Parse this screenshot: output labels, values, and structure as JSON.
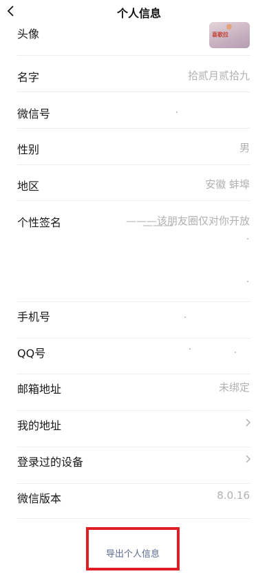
{
  "header": {
    "title": "个人信息"
  },
  "rows": {
    "avatar": {
      "label": "头像",
      "thumb_text": "喜歌拉"
    },
    "name": {
      "label": "名字",
      "value": "拾贰月贰拾九"
    },
    "wechat_id": {
      "label": "微信号",
      "value": ""
    },
    "gender": {
      "label": "性别",
      "value": "男"
    },
    "region": {
      "label": "地区",
      "value": "安徽 蚌埠"
    },
    "signature": {
      "label": "个性签名",
      "value_line1": "———该朋友圈仅对你开放",
      "value_line2": "———"
    },
    "phone": {
      "label": "手机号",
      "value": ""
    },
    "qq": {
      "label": "QQ号",
      "value": ""
    },
    "email": {
      "label": "邮箱地址",
      "value": "未绑定"
    },
    "address": {
      "label": "我的地址"
    },
    "devices": {
      "label": "登录过的设备"
    },
    "version": {
      "label": "微信版本",
      "value": "8.0.16"
    }
  },
  "footer": {
    "export_label": "导出个人信息"
  },
  "colors": {
    "accent_red": "#e01c25",
    "link_blue": "#586891",
    "muted": "#b0b0b0"
  }
}
